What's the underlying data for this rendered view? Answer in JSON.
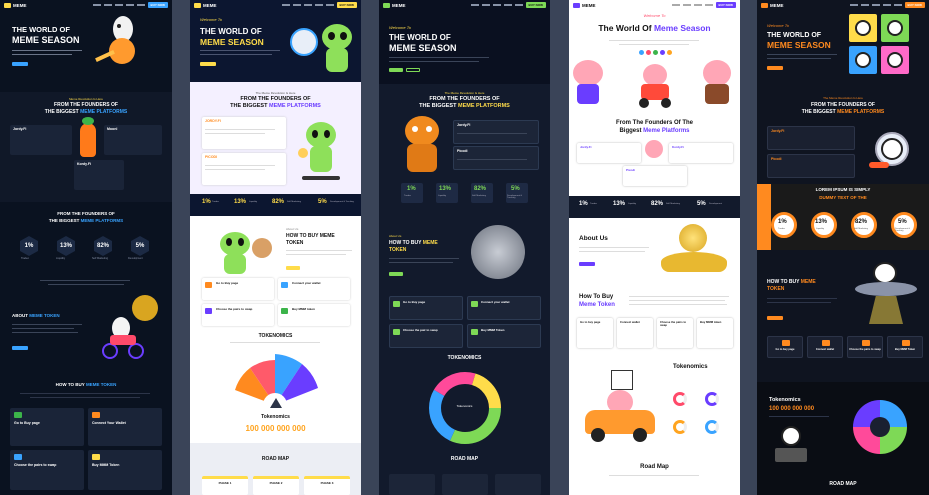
{
  "colors": {
    "yellow": "#ffdc4a",
    "blue": "#39a3ff",
    "orange": "#ff8a1f",
    "purple": "#6a3dff",
    "dark": "#0a1220"
  },
  "strip1": {
    "logo": "MEME",
    "buy": "BUY NOW",
    "hero_line1": "THE WORLD OF",
    "hero_line2": "MEME SEASON",
    "founders_small": "Meme Revolution Is Here",
    "founders1": "FROM THE FOUNDERS OF",
    "founders2": "THE BIGGEST",
    "founders3": "MEME PLATFORMS",
    "card_a": "Jordy.Fi",
    "card_b": "Moonl",
    "card_c": "Kordy.Fi",
    "stats_title1": "FROM THE FOUNDERS OF",
    "stats_title2": "THE BIGGEST",
    "stats_title3": "MEME PLATFORMS",
    "stats": [
      {
        "v": "1%",
        "l": "Tradeo"
      },
      {
        "v": "13%",
        "l": "Liquidity"
      },
      {
        "v": "82%",
        "l": "Self Marketing"
      },
      {
        "v": "5%",
        "l": "Development"
      }
    ],
    "about1": "ABOUT",
    "about2": "MEME TOKEN",
    "howto1": "HOW TO BUY",
    "howto2": "MEME TOKEN",
    "steps": [
      "Go to Buy page",
      "Connect Your Wallet",
      "Choose the pairs to swap",
      "Buy MMM Token"
    ]
  },
  "strip2": {
    "logo": "MEME",
    "buy": "BUY NOW",
    "welcome": "Welcome To",
    "hero_line1": "THE WORLD OF",
    "hero_line2": "MEME SEASON",
    "founders_small": "The Meme Revolution Is Here",
    "founders1": "FROM THE FOUNDERS OF",
    "founders2": "THE BIGGEST",
    "founders3": "MEME PLATFORMS",
    "card_a": "JORDY.FI",
    "card_b": "PICODI",
    "stats": [
      {
        "v": "1%",
        "l": "Tradeo"
      },
      {
        "v": "13%",
        "l": "Liquidity"
      },
      {
        "v": "82%",
        "l": "Self Marketing"
      },
      {
        "v": "5%",
        "l": "Development & Tracking"
      }
    ],
    "about_small": "About Us",
    "howto1": "HOW TO BUY MEME",
    "howto2": "TOKEN",
    "steps": [
      "Go to Buy page",
      "Connect your wallet",
      "Choose the pairs to swap",
      "Buy MMM token"
    ],
    "tokenomics": "TOKENOMICS",
    "tok_label": "Tokenomics",
    "tok_value": "100 000 000 000",
    "roadmap": "ROAD MAP",
    "phases": [
      "PHASE 1",
      "PHASE 2",
      "PHASE 3"
    ]
  },
  "strip3": {
    "logo": "MEME",
    "buy": "BUY NOW",
    "welcome": "Welcome To",
    "hero_line1": "THE WORLD OF",
    "hero_line2": "MEME SEASON",
    "founders_small": "The Meme Revolution Is Here",
    "founders1": "FROM THE FOUNDERS OF",
    "founders2": "THE BIGGEST",
    "founders3": "MEME PLATFORMS",
    "card_a": "Jordy.Fi",
    "card_b": "Picodi",
    "stats": [
      {
        "v": "1%",
        "l": "Tradeo"
      },
      {
        "v": "13%",
        "l": "Liquidity"
      },
      {
        "v": "82%",
        "l": "Self Marketing"
      },
      {
        "v": "5%",
        "l": "Development & Tracking"
      }
    ],
    "about_small": "About Us",
    "howto1": "HOW TO BUY",
    "howto2": "MEME",
    "howto3": "TOKEN",
    "steps": [
      "Go to Buy page",
      "Connect your wallet",
      "Choose the pair to swap",
      "Buy MMM Token"
    ],
    "tokenomics": "TOKENOMICS",
    "donut_center": "Tokenomics",
    "roadmap": "ROAD MAP"
  },
  "strip4": {
    "logo": "MEME",
    "buy": "BUY NOW",
    "welcome": "Welcome To",
    "hero_line1": "The World Of",
    "hero_line2": "Meme Season",
    "founders1": "From The Founders Of The",
    "founders2": "Biggest",
    "founders3": "Meme Platforms",
    "card_a": "Jordy.Fi",
    "card_b": "Kordy.Fi",
    "card_c": "Picodi",
    "stats": [
      {
        "v": "1%",
        "l": "Tradeo"
      },
      {
        "v": "13%",
        "l": "Liquidity"
      },
      {
        "v": "82%",
        "l": "Self Marketing"
      },
      {
        "v": "5%",
        "l": "Development"
      }
    ],
    "about": "About Us",
    "howto1": "How To Buy",
    "howto2": "Meme Token",
    "steps": [
      "Go to buy page",
      "Connect wallet",
      "Choose the pairs to swap",
      "Buy MMM token"
    ],
    "tokenomics": "Tokenomics",
    "roadmap": "Road Map"
  },
  "strip5": {
    "logo": "MEME",
    "buy": "BUY NOW",
    "welcome": "Welcome To",
    "hero_line1": "THE WORLD OF",
    "hero_line2": "MEME SEASON",
    "founders_small": "The Meme Revolution Is Here",
    "founders1": "FROM THE FOUNDERS OF",
    "founders2": "THE BIGGEST",
    "founders3": "MEME PLATFORMS",
    "card_a": "Jordy.Fi",
    "card_b": "Picodi",
    "lorem1": "LOREM IPSUM IS SIMPLY",
    "lorem2": "DUMMY TEXT OF THE",
    "stats": [
      {
        "v": "1%",
        "l": "Tradeo"
      },
      {
        "v": "13%",
        "l": "Liquidity"
      },
      {
        "v": "82%",
        "l": "Self Marketing"
      },
      {
        "v": "5%",
        "l": "Development & Tracking"
      }
    ],
    "howto1": "HOW TO BUY",
    "howto2": "MEME",
    "howto3": "TOKEN",
    "steps": [
      "Go to buy page",
      "Connect wallet",
      "Choose the pairs to swap",
      "Buy MMM Token"
    ],
    "tokenomics": "Tokenomics",
    "tok_value": "100 000 000 000",
    "roadmap": "ROAD MAP"
  }
}
